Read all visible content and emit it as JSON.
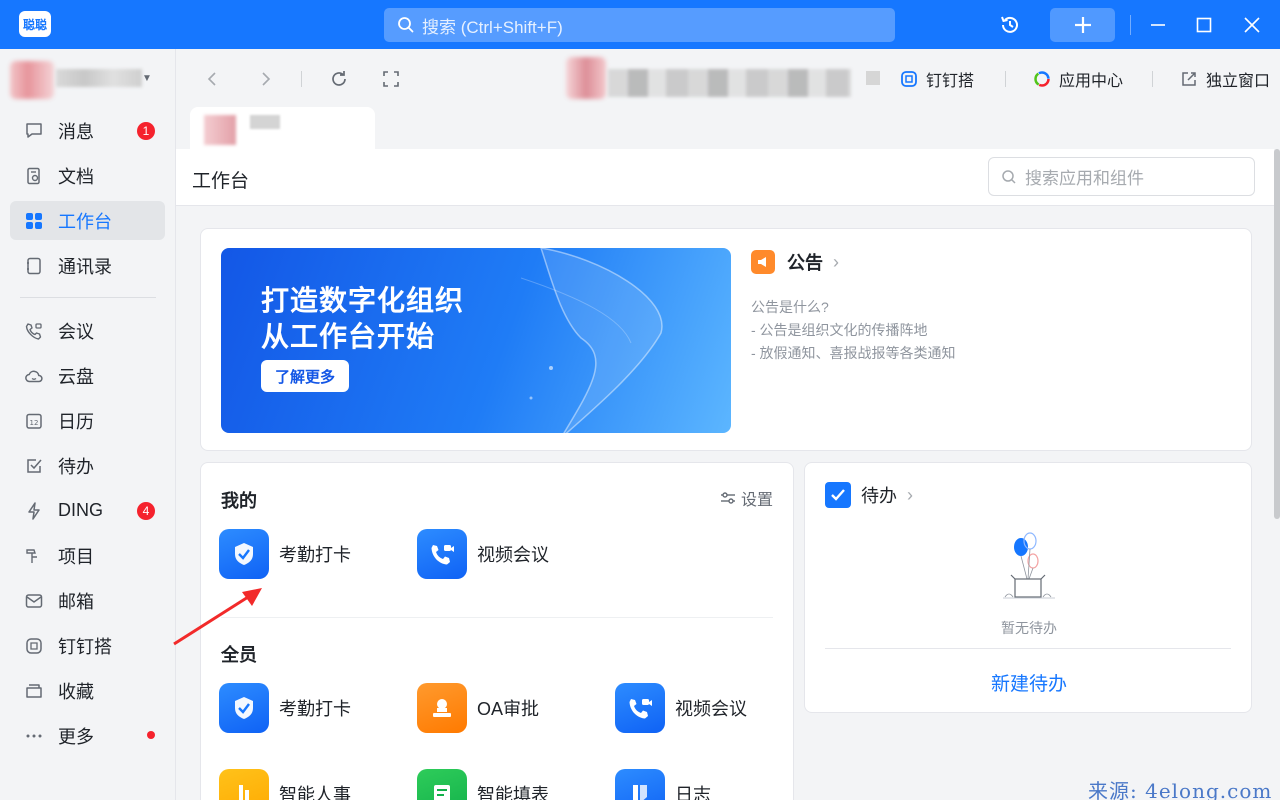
{
  "app": {
    "logo_text": "聪聪"
  },
  "search": {
    "placeholder": "搜索 (Ctrl+Shift+F)"
  },
  "sidebar": {
    "items": [
      {
        "label": "消息",
        "badge": "1",
        "icon": "message-icon"
      },
      {
        "label": "文档",
        "icon": "document-icon"
      },
      {
        "label": "工作台",
        "icon": "workbench-icon",
        "active": true
      },
      {
        "label": "通讯录",
        "icon": "contacts-icon"
      },
      {
        "label": "会议",
        "icon": "meeting-icon"
      },
      {
        "label": "云盘",
        "icon": "cloud-icon"
      },
      {
        "label": "日历",
        "icon": "calendar-icon",
        "icon_text": "12"
      },
      {
        "label": "待办",
        "icon": "todo-icon"
      },
      {
        "label": "DING",
        "badge": "4",
        "icon": "ding-icon"
      },
      {
        "label": "项目",
        "icon": "project-icon"
      },
      {
        "label": "邮箱",
        "icon": "mail-icon"
      },
      {
        "label": "钉钉搭",
        "icon": "dingda-icon"
      },
      {
        "label": "收藏",
        "icon": "favorites-icon"
      },
      {
        "label": "更多",
        "icon": "more-icon",
        "dot": true
      }
    ]
  },
  "toolbar": {
    "dingda_label": "钉钉搭",
    "app_center_label": "应用中心",
    "window_label": "独立窗口"
  },
  "main": {
    "title": "工作台",
    "search_placeholder": "搜索应用和组件",
    "banner": {
      "line1": "打造数字化组织",
      "line2": "从工作台开始",
      "button": "了解更多"
    },
    "notice": {
      "title": "公告",
      "lines": [
        "公告是什么?",
        "- 公告是组织文化的传播阵地",
        "- 放假通知、喜报战报等各类通知"
      ]
    },
    "mine": {
      "title": "我的",
      "settings": "设置",
      "apps": [
        {
          "label": "考勤打卡",
          "icon": "attendance-icon"
        },
        {
          "label": "视频会议",
          "icon": "video-meeting-icon"
        }
      ]
    },
    "all": {
      "title": "全员",
      "apps": [
        {
          "label": "考勤打卡",
          "icon": "attendance-icon"
        },
        {
          "label": "OA审批",
          "icon": "oa-approval-icon"
        },
        {
          "label": "视频会议",
          "icon": "video-meeting-icon"
        },
        {
          "label": "智能人事",
          "icon": "smart-hr-icon"
        },
        {
          "label": "智能填表",
          "icon": "smart-form-icon"
        },
        {
          "label": "日志",
          "icon": "log-icon"
        }
      ]
    },
    "todo": {
      "title": "待办",
      "empty": "暂无待办",
      "new_button": "新建待办"
    }
  },
  "watermark": "来源: 4elong.com",
  "colors": {
    "accent": "#1677ff",
    "badge": "#f5222d"
  }
}
